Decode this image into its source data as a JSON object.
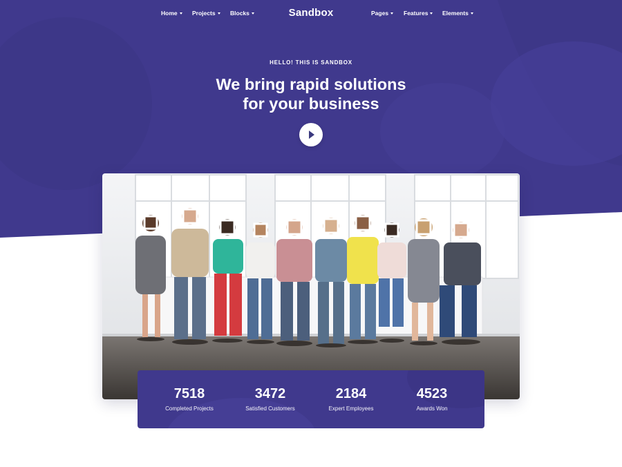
{
  "brand": {
    "name": "Sandbox"
  },
  "colors": {
    "primary": "#40398d",
    "primary_light": "#4a43a0",
    "white": "#ffffff"
  },
  "nav": {
    "left": [
      {
        "label": "Home"
      },
      {
        "label": "Projects"
      },
      {
        "label": "Blocks"
      }
    ],
    "right": [
      {
        "label": "Pages"
      },
      {
        "label": "Features"
      },
      {
        "label": "Elements"
      }
    ]
  },
  "hero": {
    "eyebrow": "HELLO! THIS IS SANDBOX",
    "headline_line1": "We bring rapid solutions",
    "headline_line2": "for your business",
    "play_icon": "play-icon"
  },
  "stats": [
    {
      "value": "7518",
      "label": "Completed Projects"
    },
    {
      "value": "3472",
      "label": "Satisfied Customers"
    },
    {
      "value": "2184",
      "label": "Expert Employees"
    },
    {
      "value": "4523",
      "label": "Awards Won"
    }
  ]
}
